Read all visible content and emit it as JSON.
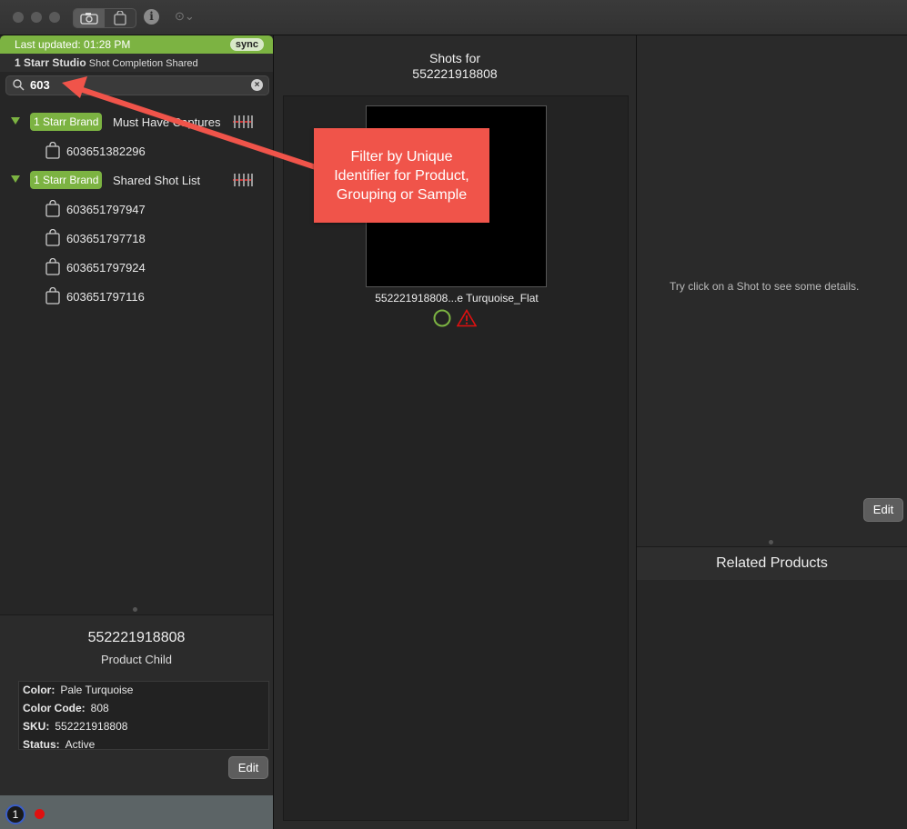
{
  "left_panel": {
    "status": "Last updated: 01:28 PM",
    "sync_label": "sync",
    "studio_name": "1 Starr Studio",
    "studio_sub": "Shot Completion Shared",
    "search_value": "603",
    "groups": [
      {
        "brand": "1 Starr Brand",
        "name": "Must Have Captures",
        "items": [
          "603651382296"
        ]
      },
      {
        "brand": "1 Starr Brand",
        "name": "Shared Shot List",
        "items": [
          "603651797947",
          "603651797718",
          "603651797924",
          "603651797116"
        ]
      }
    ],
    "detail": {
      "title": "552221918808",
      "subtitle": "Product Child",
      "fields": [
        {
          "label": "Color:",
          "value": "Pale Turquoise"
        },
        {
          "label": "Color Code:",
          "value": "808"
        },
        {
          "label": "SKU:",
          "value": "552221918808"
        },
        {
          "label": "Status:",
          "value": "Active"
        }
      ],
      "edit_label": "Edit"
    },
    "footer_badge": "1"
  },
  "middle_panel": {
    "header_line1": "Shots for",
    "header_line2": "552221918808",
    "shot_caption": "552221918808...e Turquoise_Flat"
  },
  "right_panel": {
    "hint": "Try click on a Shot to see some details.",
    "edit_label": "Edit",
    "related_title": "Related Products"
  },
  "annotation": {
    "text": "Filter by Unique Identifier for Product, Grouping or Sample",
    "color": "#f0544a"
  },
  "colors": {
    "accent": "#7cb342",
    "warning": "#e01010"
  }
}
